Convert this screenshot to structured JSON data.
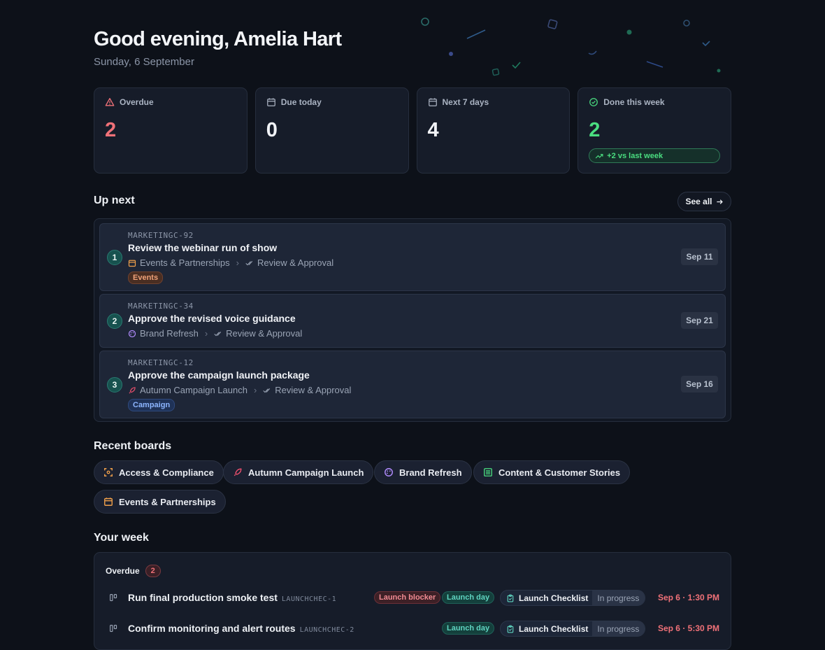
{
  "greeting": "Good evening, Amelia Hart",
  "date": "Sunday, 6 September",
  "stats": [
    {
      "label": "Overdue",
      "value": "2",
      "icon": "warning-icon"
    },
    {
      "label": "Due today",
      "value": "0",
      "icon": "calendar-icon"
    },
    {
      "label": "Next 7 days",
      "value": "4",
      "icon": "calendar-icon"
    },
    {
      "label": "Done this week",
      "value": "2",
      "icon": "check-circle-icon",
      "delta": "+2 vs last week"
    }
  ],
  "up_next": {
    "title": "Up next",
    "see_all": "See all",
    "items": [
      {
        "index": "1",
        "code": "MARKETINGC-92",
        "title": "Review the webinar run of show",
        "board": "Events & Partnerships",
        "stage": "Review & Approval",
        "tag": "Events",
        "due": "Sep 11"
      },
      {
        "index": "2",
        "code": "MARKETINGC-34",
        "title": "Approve the revised voice guidance",
        "board": "Brand Refresh",
        "stage": "Review & Approval",
        "due": "Sep 21"
      },
      {
        "index": "3",
        "code": "MARKETINGC-12",
        "title": "Approve the campaign launch package",
        "board": "Autumn Campaign Launch",
        "stage": "Review & Approval",
        "tag": "Campaign",
        "due": "Sep 16"
      }
    ]
  },
  "recent_boards": {
    "title": "Recent boards",
    "items": [
      "Access & Compliance",
      "Autumn Campaign Launch",
      "Brand Refresh",
      "Content & Customer Stories",
      "Events & Partnerships"
    ]
  },
  "your_week": {
    "title": "Your week",
    "group_label": "Overdue",
    "group_count": "2",
    "rows": [
      {
        "title": "Run final production smoke test",
        "code": "LAUNCHCHEC-1",
        "tags": [
          "Launch blocker",
          "Launch day"
        ],
        "board": "Launch Checklist",
        "status": "In progress",
        "when": "Sep 6 · 1:30 PM"
      },
      {
        "title": "Confirm monitoring and alert routes",
        "code": "LAUNCHCHEC-2",
        "tags": [
          "Launch day"
        ],
        "board": "Launch Checklist",
        "status": "In progress",
        "when": "Sep 6 · 5:30 PM"
      }
    ]
  },
  "colors": {
    "accent": "#4ade80",
    "danger": "#f07178",
    "background": "#0d1119"
  }
}
